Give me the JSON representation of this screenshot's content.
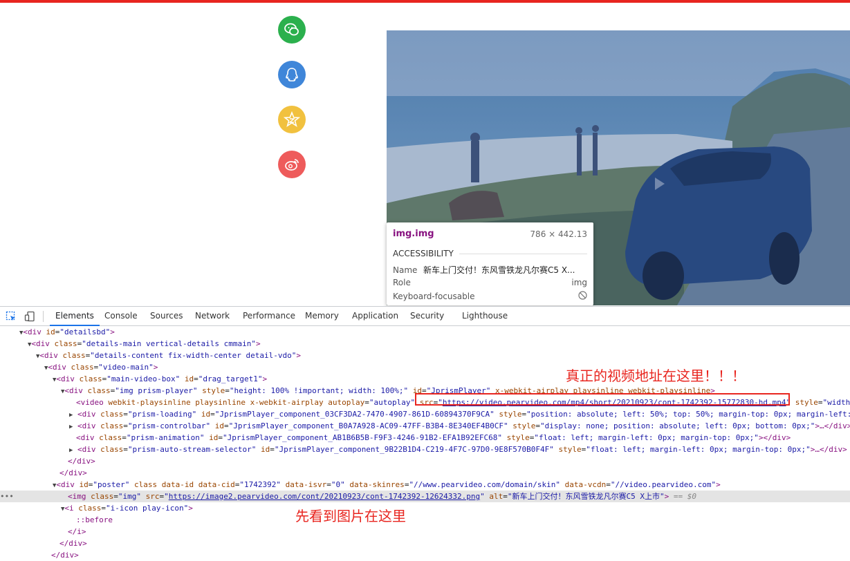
{
  "share_icons": [
    {
      "name": "wechat-icon",
      "color": "#2bb04d"
    },
    {
      "name": "qq-icon",
      "color": "#3f86d9"
    },
    {
      "name": "qzone-icon",
      "color": "#f1c13f"
    },
    {
      "name": "weibo-icon",
      "color": "#ee5b5b"
    }
  ],
  "video": {
    "play_icon": "play-icon"
  },
  "tooltip": {
    "element": "img.img",
    "size": "786 × 442.13",
    "section": "ACCESSIBILITY",
    "name_label": "Name",
    "name_value": "新车上门交付！东风雪铁龙凡尔赛C5 X...",
    "role_label": "Role",
    "role_value": "img",
    "focus_label": "Keyboard-focusable"
  },
  "devtools": {
    "tabs": [
      "Elements",
      "Console",
      "Sources",
      "Network",
      "Performance",
      "Memory",
      "Application",
      "Security",
      "Lighthouse"
    ],
    "active_tab": "Elements"
  },
  "dom": {
    "l0": {
      "tri": "▼",
      "open": "<div ",
      "a1": "id",
      "v1": "\"detailsbd\"",
      "close": ">"
    },
    "l1": {
      "tri": "▼",
      "open": "<div ",
      "a1": "class",
      "v1": "\"details-main vertical-details cmmain\"",
      "close": ">"
    },
    "l2": {
      "tri": "▼",
      "open": "<div ",
      "a1": "class",
      "v1": "\"details-content fix-width-center detail-vdo\"",
      "close": ">"
    },
    "l3": {
      "tri": "▼",
      "open": "<div ",
      "a1": "class",
      "v1": "\"video-main\"",
      "close": ">"
    },
    "l4": {
      "tri": "▼",
      "open": "<div ",
      "a1": "class",
      "v1": "\"main-video-box\"",
      "a2": "id",
      "v2": "\"drag_target1\"",
      "close": ">"
    },
    "l5": {
      "tri": "▼",
      "open": "<div ",
      "a1": "class",
      "v1": "\"img prism-player\"",
      "a2": "style",
      "v2": "\"height: 100% !important; width: 100%;\"",
      "a3": "id",
      "v3": "\"JprismPlayer\"",
      "a4": "x-webkit-airplay playsinline webkit-playsinline",
      "close": ">"
    },
    "l6": {
      "open": "<video ",
      "a1": "webkit-playsinline playsinline x-webkit-airplay autoplay",
      "v1": "\"autoplay\"",
      "a2": "src",
      "q": "\"",
      "link": "https://video.pearvideo.com/mp4/short/20210923/cont-1742392-15772830-hd.mp4",
      "a3": "style",
      "v3": "\"width:"
    },
    "l7": {
      "tri": "▶",
      "open": "<div ",
      "a1": "class",
      "v1": "\"prism-loading\"",
      "a2": "id",
      "v2": "\"JprismPlayer_component_03CF3DA2-7470-4907-861D-60894370F9CA\"",
      "a3": "style",
      "v3": "\"position: absolute; left: 50%; top: 50%; margin-top: 0px; margin-left:"
    },
    "l8": {
      "tri": "▶",
      "open": "<div ",
      "a1": "class",
      "v1": "\"prism-controlbar\"",
      "a2": "id",
      "v2": "\"JprismPlayer_component_B0A7A928-AC09-47FF-B3B4-8E340EF4B0CF\"",
      "a3": "style",
      "v3": "\"display: none; position: absolute; left: 0px; bottom: 0px;\"",
      "close": ">…</div>"
    },
    "l9": {
      "open": "<div ",
      "a1": "class",
      "v1": "\"prism-animation\"",
      "a2": "id",
      "v2": "\"JprismPlayer_component_AB1B6B5B-F9F3-4246-91B2-EFA1B92EFC68\"",
      "a3": "style",
      "v3": "\"float: left; margin-left: 0px; margin-top: 0px;\"",
      "close": "></div>"
    },
    "l10": {
      "tri": "▶",
      "open": "<div ",
      "a1": "class",
      "v1": "\"prism-auto-stream-selector\"",
      "a2": "id",
      "v2": "\"JprismPlayer_component_9B22B1D4-C219-4F7C-97D0-9E8F570B0F4F\"",
      "a3": "style",
      "v3": "\"float: left; margin-left: 0px; margin-top: 0px;\"",
      "close": ">…</div>"
    },
    "l11": {
      "close": "</div>"
    },
    "l12": {
      "close": "</div>"
    },
    "l13": {
      "tri": "▼",
      "open": "<div ",
      "a1": "id",
      "v1": "\"poster\"",
      "a2": "class data-id data-cid",
      "v2": "\"1742392\"",
      "a3": "data-isvr",
      "v3": "\"0\"",
      "a4": "data-skinres",
      "v4": "\"//www.pearvideo.com/domain/skin\"",
      "a5": "data-vcdn",
      "v5": "\"//video.pearvideo.com\"",
      "close": ">"
    },
    "l14": {
      "dots": "•••",
      "open": "<img ",
      "a1": "class",
      "v1": "\"img\"",
      "a2": "src",
      "q": "\"",
      "link": "https://image2.pearvideo.com/cont/20210923/cont-1742392-12624332.png",
      "a3": "alt",
      "v3": "\"新车上门交付！东风雪铁龙凡尔赛C5 X上市\"",
      "close": ">",
      "eq": "== $0"
    },
    "l15": {
      "tri": "▼",
      "open": "<i ",
      "a1": "class",
      "v1": "\"i-icon play-icon\"",
      "close": ">"
    },
    "l16": {
      "pseudo": "::before"
    },
    "l17": {
      "close": "</i>"
    },
    "l18": {
      "close": "</div>"
    },
    "l19": {
      "close": "</div>"
    }
  },
  "annotations": {
    "video_note": "真正的视频地址在这里！！！",
    "image_note": "先看到图片在这里"
  },
  "colors": {
    "annotation": "#e8251f",
    "tab_active": "#1a73e8",
    "tag": "#881280",
    "attr_name": "#994500",
    "attr_value": "#1a1aa6"
  }
}
